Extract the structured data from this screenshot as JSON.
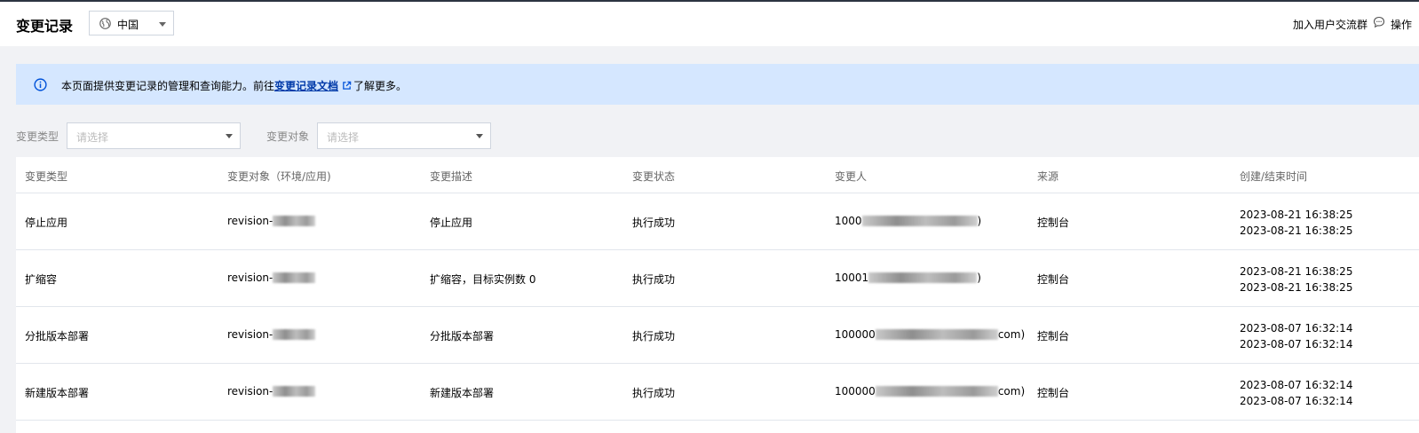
{
  "header": {
    "title": "变更记录",
    "region": {
      "selected": "中国",
      "icon": "globe-icon"
    },
    "join_group": "加入用户交流群",
    "ops_label": "操作",
    "chat_icon": "chat-bubble-icon"
  },
  "banner": {
    "icon": "info-icon",
    "text_before": "本页面提供变更记录的管理和查询能力。前往",
    "link_text": "变更记录文档",
    "text_after": "了解更多。",
    "link_icon": "external-link-icon",
    "background": "#d5e7ff"
  },
  "filters": {
    "type_label": "变更类型",
    "type_placeholder": "请选择",
    "target_label": "变更对象",
    "target_placeholder": "请选择"
  },
  "table": {
    "columns": [
      "变更类型",
      "变更对象（环境/应用)",
      "变更描述",
      "变更状态",
      "变更人",
      "来源",
      "创建/结束时间"
    ],
    "rows": [
      {
        "type": "停止应用",
        "target": "revision-",
        "description": "停止应用",
        "status": "执行成功",
        "operator": "1000",
        "operator_suffix": ")",
        "source": "控制台",
        "created": "2023-08-21 16:38:25",
        "ended": "2023-08-21 16:38:25"
      },
      {
        "type": "扩缩容",
        "target": "revision-",
        "description": "扩缩容，目标实例数 0",
        "status": "执行成功",
        "operator": "10001",
        "operator_suffix": ")",
        "source": "控制台",
        "created": "2023-08-21 16:38:25",
        "ended": "2023-08-21 16:38:25"
      },
      {
        "type": "分批版本部署",
        "target": "revision-",
        "description": "分批版本部署",
        "status": "执行成功",
        "operator": "100000",
        "operator_suffix": "com)",
        "source": "控制台",
        "created": "2023-08-07 16:32:14",
        "ended": "2023-08-07 16:32:14"
      },
      {
        "type": "新建版本部署",
        "target": "revision-",
        "description": "新建版本部署",
        "status": "执行成功",
        "operator": "100000",
        "operator_suffix": "com)",
        "source": "控制台",
        "created": "2023-08-07 16:32:14",
        "ended": "2023-08-07 16:32:14"
      }
    ]
  }
}
